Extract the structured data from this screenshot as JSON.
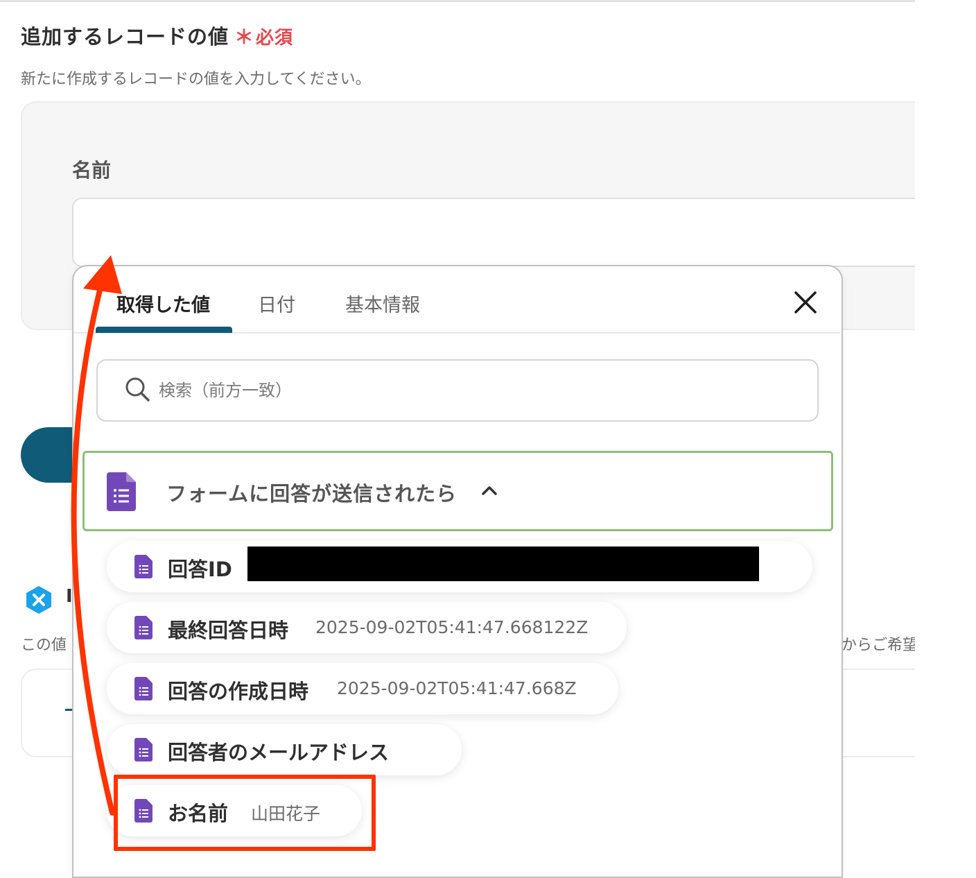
{
  "section": {
    "title": "追加するレコードの値",
    "required_star": "＊",
    "required_label": "必須",
    "description": "新たに作成するレコードの値を入力してください。"
  },
  "field": {
    "label": "名前",
    "value": ""
  },
  "background": {
    "glyph": "I",
    "desc_left": "この値",
    "desc_right": "からご希望"
  },
  "popup": {
    "tabs": [
      {
        "label": "取得した値",
        "active": true
      },
      {
        "label": "日付",
        "active": false
      },
      {
        "label": "基本情報",
        "active": false
      }
    ],
    "search_placeholder": "検索（前方一致）",
    "group": {
      "label": "フォームに回答が送信されたら",
      "icon": "google-forms-icon",
      "expanded": true
    },
    "items": [
      {
        "label": "回答ID",
        "value": ""
      },
      {
        "label": "最終回答日時",
        "value": "2025-09-02T05:41:47.668122Z"
      },
      {
        "label": "回答の作成日時",
        "value": "2025-09-02T05:41:47.668Z"
      },
      {
        "label": "回答者のメールアドレス",
        "value": ""
      },
      {
        "label": "お名前",
        "value": "山田花子"
      }
    ]
  },
  "colors": {
    "accent": "#0f5b78",
    "required": "#e5484d",
    "highlight": "#ff3300",
    "group_border": "#8dbe79",
    "forms_purple": "#7248b9"
  }
}
